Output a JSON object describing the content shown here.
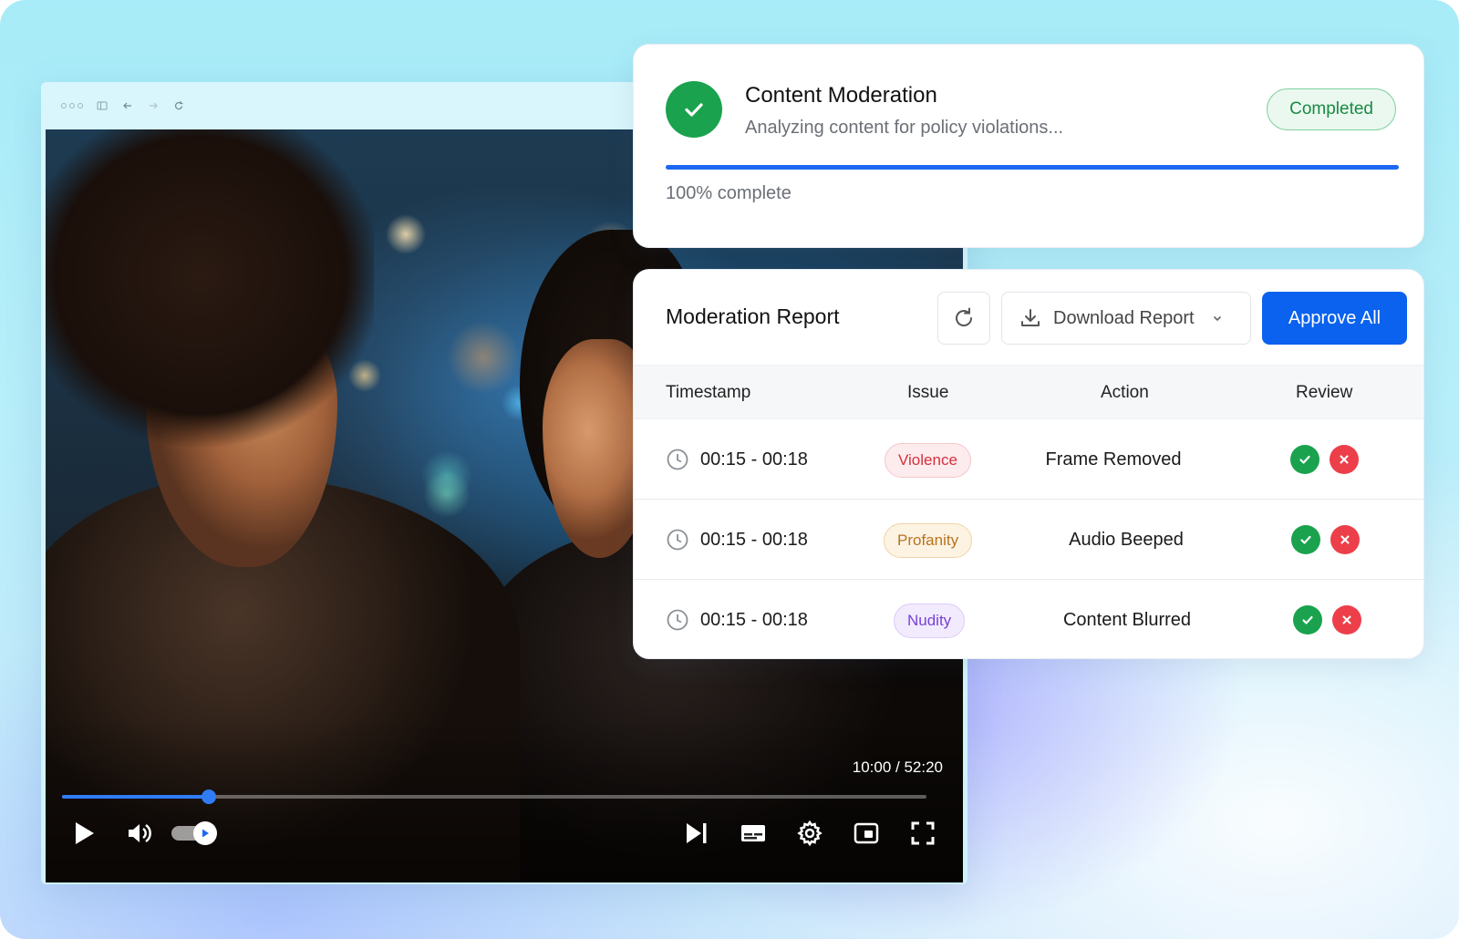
{
  "browser": {
    "icons": [
      "window-dots",
      "sidebar-icon",
      "back-arrow-icon",
      "forward-arrow-icon",
      "reload-icon"
    ]
  },
  "video": {
    "time": "10:00 / 52:20",
    "progress_fraction": 0.17,
    "controls": [
      "play-icon",
      "volume-icon",
      "autoplay-toggle",
      "skip-next-icon",
      "subtitles-icon",
      "settings-gear-icon",
      "miniplayer-icon",
      "fullscreen-icon"
    ]
  },
  "status": {
    "title": "Content Moderation",
    "subtitle": "Analyzing content for policy violations...",
    "badge": "Completed",
    "progress_percent": 100,
    "progress_text": "100% complete"
  },
  "report": {
    "title": "Moderation Report",
    "download_label": "Download Report",
    "approve_label": "Approve All",
    "columns": {
      "timestamp": "Timestamp",
      "issue": "Issue",
      "action": "Action",
      "review": "Review"
    },
    "rows": [
      {
        "timestamp": "00:15 - 00:18",
        "issue": "Violence",
        "action": "Frame Removed"
      },
      {
        "timestamp": "00:15 - 00:18",
        "issue": "Profanity",
        "action": "Audio Beeped"
      },
      {
        "timestamp": "00:15 - 00:18",
        "issue": "Nudity",
        "action": "Content Blurred"
      }
    ]
  },
  "colors": {
    "accent": "#0a62ee",
    "success": "#1aa24e",
    "danger": "#ec3f4a"
  }
}
